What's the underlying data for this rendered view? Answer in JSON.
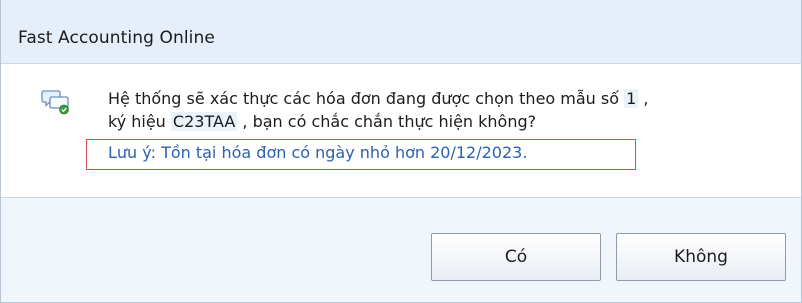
{
  "window": {
    "title": "Fast Accounting Online"
  },
  "message": {
    "line1_prefix": "Hệ thống sẽ xác thực các hóa đơn đang được chọn theo mẫu số",
    "form_number": "1",
    "line1_suffix": ",",
    "line2_prefix": "ký hiệu",
    "symbol": "C23TAA",
    "line2_suffix": ", bạn có chắc chắn thực hiện không?",
    "note": "Lưu ý: Tồn tại hóa đơn có ngày nhỏ hơn 20/12/2023.",
    "icon": "message-bubble-icon"
  },
  "buttons": {
    "yes_label": "Có",
    "no_label": "Không"
  },
  "colors": {
    "titlebar_bg": "#e6eef9",
    "footer_bg": "#f1f5fc",
    "note_text": "#2b5fb2",
    "highlight_border": "#e04a4a"
  }
}
